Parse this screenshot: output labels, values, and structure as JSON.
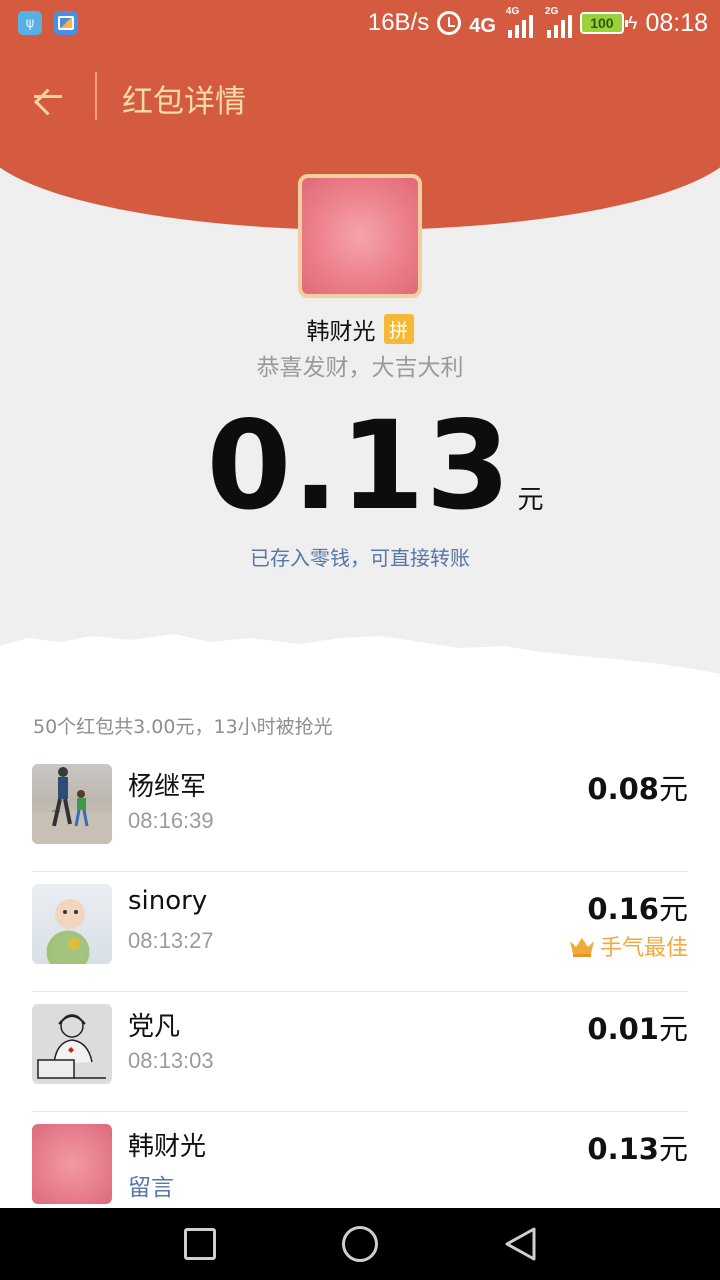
{
  "status_bar": {
    "net_speed": "16B/s",
    "gen_big": "4G",
    "gen_small_1": "4G",
    "gen_small_2": "2G",
    "battery": "100",
    "time": "08:18"
  },
  "header": {
    "title": "红包详情"
  },
  "sender": {
    "name": "韩财光",
    "badge": "拼",
    "greeting": "恭喜发财，大吉大利",
    "amount": "0.13",
    "amount_unit": "元",
    "saved_note": "已存入零钱，可直接转账"
  },
  "list": {
    "summary": "50个红包共3.00元，13小时被抢光",
    "items": [
      {
        "name": "杨继军",
        "time": "08:16:39",
        "amount": "0.08",
        "unit": "元"
      },
      {
        "name": "sinory",
        "time": "08:13:27",
        "amount": "0.16",
        "unit": "元",
        "tag": "手气最佳"
      },
      {
        "name": "党凡",
        "time": "08:13:03",
        "amount": "0.01",
        "unit": "元"
      },
      {
        "name": "韩财光",
        "remark": "留言",
        "amount": "0.13",
        "unit": "元"
      }
    ]
  },
  "colors": {
    "header_red": "#d55b40",
    "title_gold": "#f7dcab",
    "link_blue": "#5577a8",
    "best_luck_orange": "#f2a93b"
  }
}
